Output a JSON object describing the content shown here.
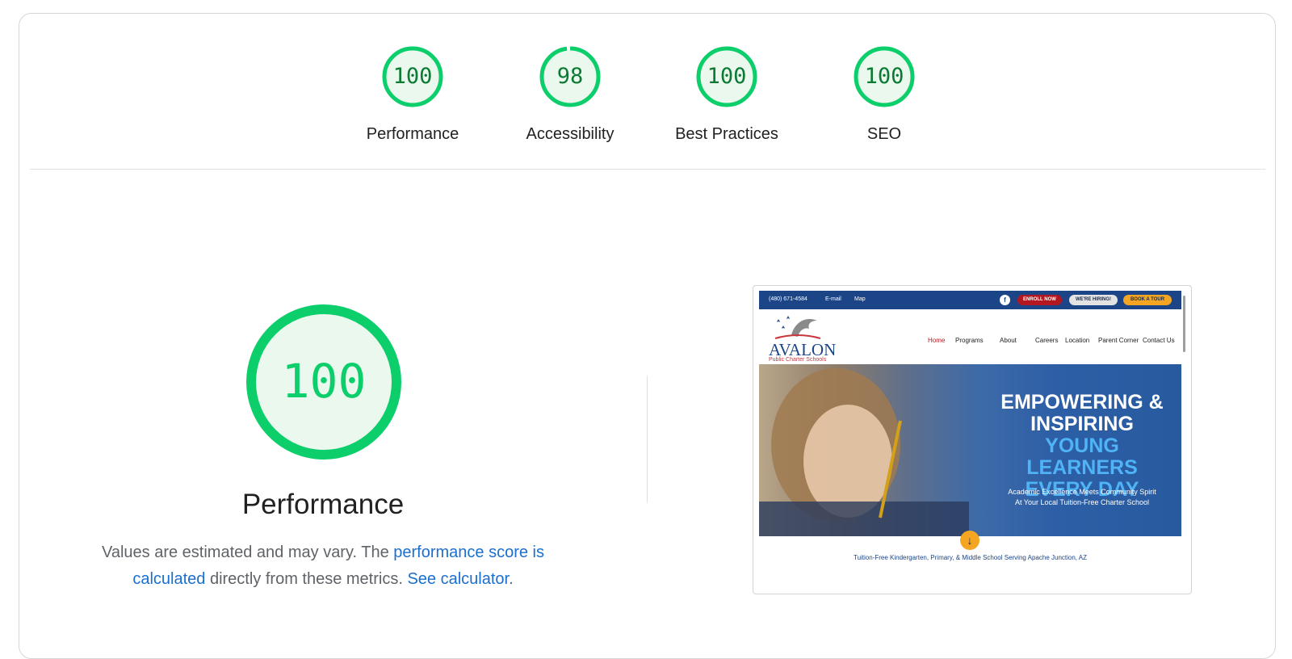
{
  "gauges": [
    {
      "score": "100",
      "value": 100,
      "label": "Performance"
    },
    {
      "score": "98",
      "value": 98,
      "label": "Accessibility"
    },
    {
      "score": "100",
      "value": 100,
      "label": "Best Practices"
    },
    {
      "score": "100",
      "value": 100,
      "label": "SEO"
    }
  ],
  "main": {
    "score": "100",
    "title": "Performance",
    "desc_prefix": "Values are estimated and may vary. The ",
    "link_score": "performance score is calculated",
    "desc_mid": " directly from these metrics. ",
    "link_calc": "See calculator",
    "desc_end": "."
  },
  "colors": {
    "pass": "#0cce6b",
    "pass_text": "#0b7a32",
    "pass_bg": "#eaf8ee",
    "link": "#1a6fd1"
  },
  "thumbnail": {
    "phone": "(480) 671-4584",
    "email": "E-mail",
    "map": "Map",
    "enroll": "ENROLL NOW",
    "hiring": "WE'RE HIRING!",
    "tour": "BOOK A TOUR",
    "logo": "AVALON",
    "logo_sub": "Public Charter Schools",
    "nav": [
      "Home",
      "Programs",
      "About",
      "Careers",
      "Location",
      "Parent Corner",
      "Contact Us"
    ],
    "hero_line1": "EMPOWERING &",
    "hero_line2": "INSPIRING",
    "hero_line3": "YOUNG LEARNERS",
    "hero_line4": "EVERY DAY",
    "hero_sub1": "Academic Excellence Meets Community Spirit",
    "hero_sub2": "At Your Local Tuition-Free Charter School",
    "tagline": "Tuition-Free Kindergarten, Primary, & Middle School Serving Apache Junction, AZ"
  }
}
